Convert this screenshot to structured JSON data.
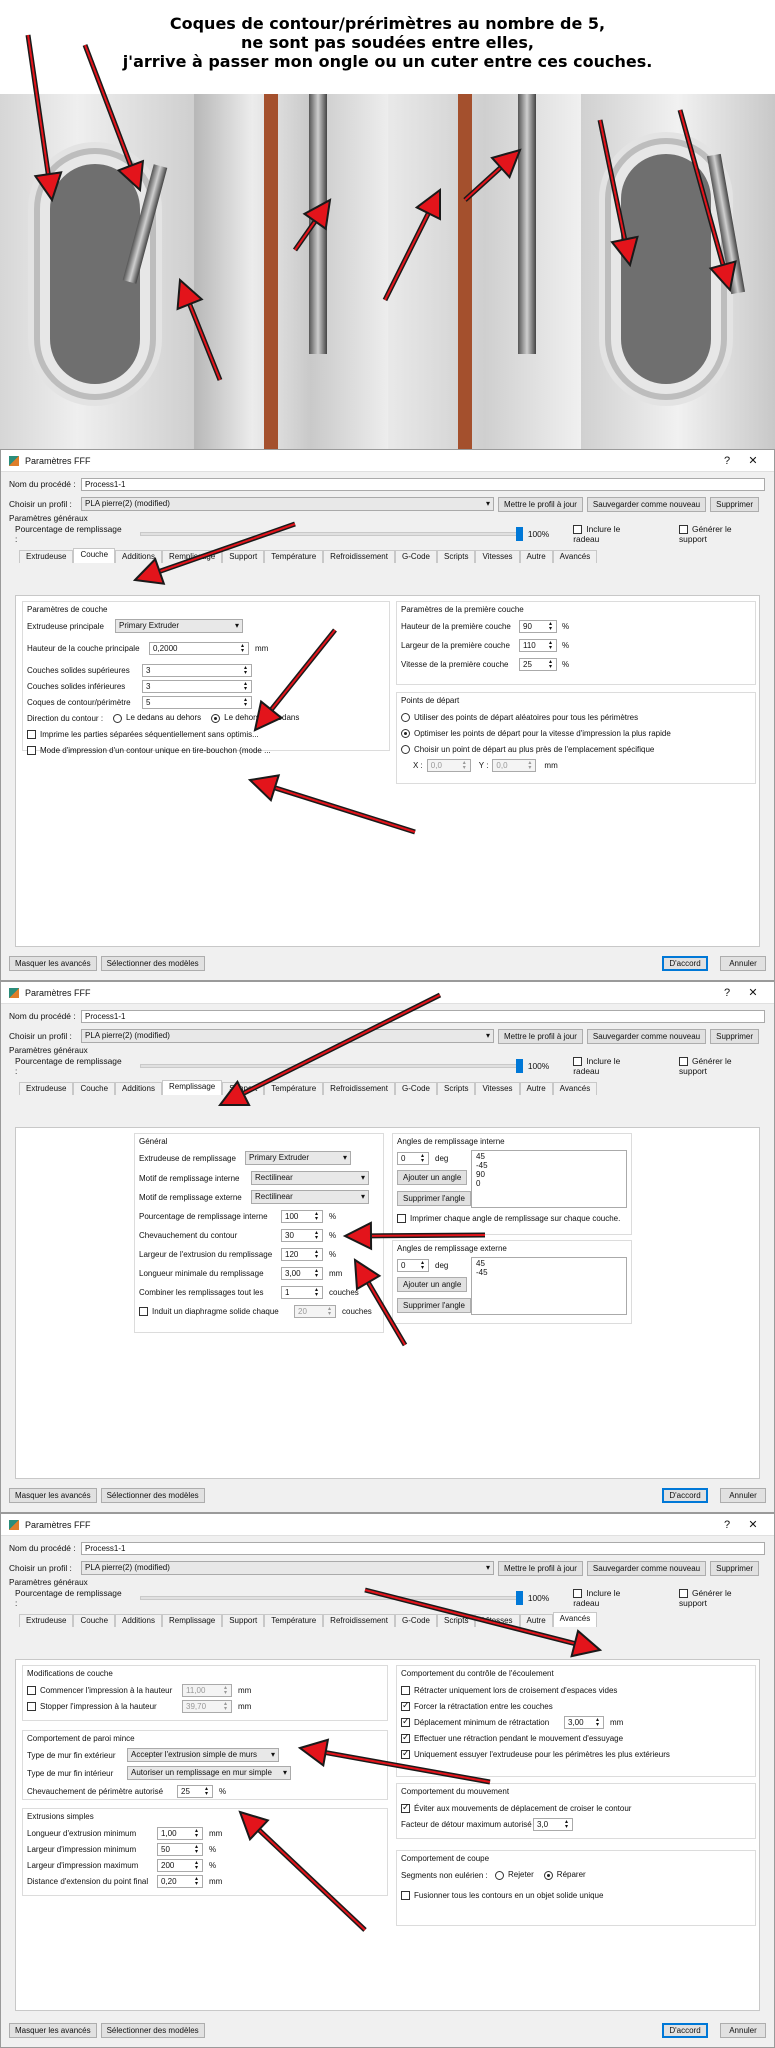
{
  "header": {
    "lines": [
      "Coques de contour/prérimètres au nombre de 5,",
      "ne sont pas soudées entre elles,",
      "j'arrive à passer mon ongle ou un cuter entre ces couches."
    ]
  },
  "common": {
    "window_title": "Paramètres FFF",
    "help_symbol": "?",
    "close_symbol": "✕",
    "name_label": "Nom du procédé :",
    "name_value": "Process1-1",
    "profile_label": "Choisir un profil :",
    "profile_value": "PLA pierre(2) (modified)",
    "update_btn": "Mettre le profil à jour",
    "save_new_btn": "Sauvegarder comme nouveau",
    "delete_btn": "Supprimer",
    "general": "Paramètres généraux",
    "fill_pct_label": "Pourcentage de remplissage :",
    "fill_pct_value": "100%",
    "raft": "Inclure le radeau",
    "support": "Générer le support",
    "tabs": [
      "Extrudeuse",
      "Couche",
      "Additions",
      "Remplissage",
      "Support",
      "Température",
      "Refroidissement",
      "G-Code",
      "Scripts",
      "Vitesses",
      "Autre",
      "Avancés"
    ],
    "hide_advanced": "Masquer les avancés",
    "select_models": "Sélectionner des modèles",
    "ok": "D'accord",
    "cancel": "Annuler",
    "icon_app": "simplify3d-icon",
    "accent": "#0078d7",
    "arrow_color": "#e3141b"
  },
  "d1": {
    "layer_group": "Paramètres de couche",
    "main_extruder_label": "Extrudeuse principale",
    "main_extruder_value": "Primary Extruder",
    "layer_height_label": "Hauteur de la couche principale",
    "layer_height_value": "0,2000",
    "mm": "mm",
    "top_label": "Couches solides supérieures",
    "top_value": "3",
    "bottom_label": "Couches solides inférieures",
    "bottom_value": "3",
    "perim_label": "Coques de contour/périmètre",
    "perim_value": "5",
    "direction_label": "Direction du contour :",
    "dir_in": "Le dedans au dehors",
    "dir_out": "Le dehors au dedans",
    "seq_label": "Imprime les parties séparées séquentiellement sans optimis...",
    "spiral_label": "Mode d'impression d'un contour unique en tire-bouchon (mode ...",
    "first_group": "Paramètres de la première couche",
    "fl_height_label": "Hauteur de la première couche",
    "fl_height_value": "90",
    "pct": "%",
    "fl_width_label": "Largeur de la première couche",
    "fl_width_value": "110",
    "fl_speed_label": "Vitesse de la première couche",
    "fl_speed_value": "25",
    "start_group": "Points de départ",
    "start_random": "Utiliser des points de départ aléatoires pour tous les périmètres",
    "start_opt": "Optimiser les points de départ pour la vitesse d'impression la plus rapide",
    "start_near": "Choisir un point de départ au plus près de l'emplacement spécifique",
    "x_label": "X :",
    "x_value": "0,0",
    "y_label": "Y :",
    "y_value": "0,0"
  },
  "d2": {
    "general_group": "Général",
    "extruder_label": "Extrudeuse de remplissage",
    "extruder_value": "Primary Extruder",
    "int_pattern_label": "Motif de remplissage interne",
    "int_pattern_value": "Rectilinear",
    "ext_pattern_label": "Motif de remplissage externe",
    "ext_pattern_value": "Rectilinear",
    "int_pct_label": "Pourcentage de remplissage interne",
    "int_pct_value": "100",
    "overlap_label": "Chevauchement du contour",
    "overlap_value": "30",
    "width_label": "Largeur de l'extrusion du remplissage",
    "width_value": "120",
    "minlen_label": "Longueur minimale du remplissage",
    "minlen_value": "3,00",
    "combine_label": "Combiner les remplissages tout les",
    "combine_value": "1",
    "combine_unit": "couches",
    "diaphragm_label": "Induit un diaphragme solide chaque",
    "diaphragm_value": "20",
    "diaphragm_unit": "couches",
    "int_angles_group": "Angles de remplissage interne",
    "int_angle_value": "0",
    "deg": "deg",
    "add_angle": "Ajouter un angle",
    "remove_angle": "Supprimer l'angle",
    "int_angles": [
      "45",
      "-45",
      "90",
      "0"
    ],
    "print_each": "Imprimer chaque angle de remplissage sur chaque couche.",
    "ext_angles_group": "Angles de remplissage externe",
    "ext_angle_value": "0",
    "ext_angles": [
      "45",
      "-45"
    ]
  },
  "d3": {
    "layer_mod_group": "Modifications de couche",
    "start_h_label": "Commencer l'impression à la hauteur",
    "start_h_value": "11,00",
    "stop_h_label": "Stopper l'impression à la hauteur",
    "stop_h_value": "39,70",
    "thin_group": "Comportement de paroi mince",
    "ext_wall_label": "Type de mur fin extérieur",
    "ext_wall_value": "Accepter l'extrusion simple de murs",
    "int_wall_label": "Type de mur fin intérieur",
    "int_wall_value": "Autoriser un remplissage en mur simple",
    "perim_overlap_label": "Chevauchement de périmètre autorisé",
    "perim_overlap_value": "25",
    "single_group": "Extrusions simples",
    "min_len_label": "Longueur d'extrusion minimum",
    "min_len_value": "1,00",
    "min_w_label": "Largeur d'impression minimum",
    "min_w_value": "50",
    "max_w_label": "Largeur d'impression maximum",
    "max_w_value": "200",
    "end_dist_label": "Distance d'extension du point final",
    "end_dist_value": "0,20",
    "ooze_group": "Comportement du contrôle de l'écoulement",
    "ooze_1": "Rétracter uniquement lors de croisement d'espaces vides",
    "ooze_2": "Forcer la rétractation entre les couches",
    "ooze_3": "Déplacement minimum de rétractation",
    "ooze_3_value": "3,00",
    "ooze_4": "Effectuer une rétraction pendant le mouvement d'essuyage",
    "ooze_5": "Uniquement essuyer l'extrudeuse pour les périmètres les plus extérieurs",
    "move_group": "Comportement du mouvement",
    "move_1": "Éviter aux mouvements de déplacement de croiser le contour",
    "detour_label": "Facteur de détour maximum autorisé",
    "detour_value": "3,0",
    "slice_group": "Comportement de coupe",
    "non_manifold": "Segments non eulérien :",
    "reject": "Rejeter",
    "repair": "Réparer",
    "merge": "Fusionner tous les contours en un objet solide unique"
  }
}
